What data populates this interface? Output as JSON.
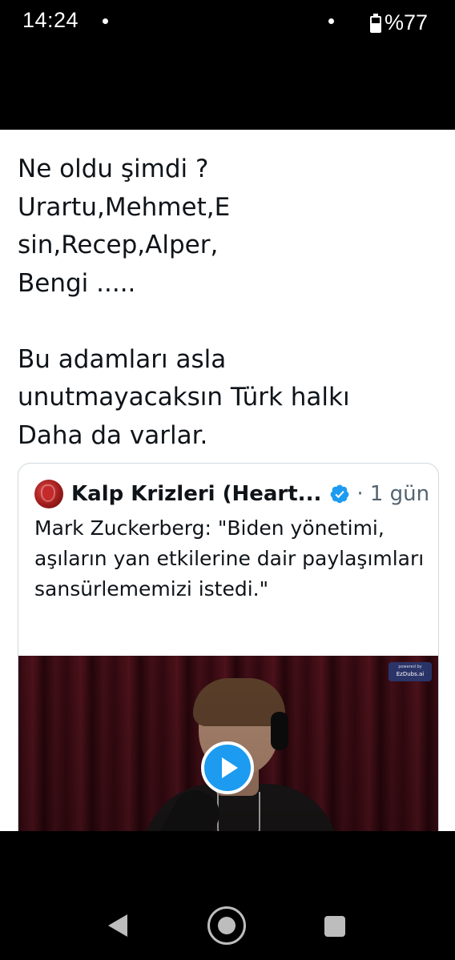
{
  "status_bar": {
    "time": "14:24",
    "battery": "%77",
    "battery_level": 0.77
  },
  "post": {
    "text": "Ne oldu şimdi ?\nUrartu,Mehmet,E\nsin,Recep,Alper,\nBengi .....\n\nBu adamları asla\nunutmayacaksın Türk halkı\nDaha da varlar."
  },
  "quote": {
    "author": "Kalp Krizleri (Heart...",
    "time": "· 1 gün",
    "text": "Mark Zuckerberg: \"Biden yönetimi, aşıların yan etkilerine dair paylaşımları sansürlememizi istedi.\"",
    "video": {
      "watermark_small": "powered by",
      "watermark": "EzDubs.ai"
    }
  },
  "colors": {
    "accent": "#1d9bf0",
    "text": "#0f1419",
    "secondary_text": "#536471",
    "border": "#cfd9de"
  },
  "icons": {
    "verified": "verified-badge-icon",
    "play": "play-icon",
    "nav_back": "back-triangle-icon",
    "nav_home": "home-circle-icon",
    "nav_recent": "recent-apps-square-icon",
    "battery": "battery-icon"
  }
}
